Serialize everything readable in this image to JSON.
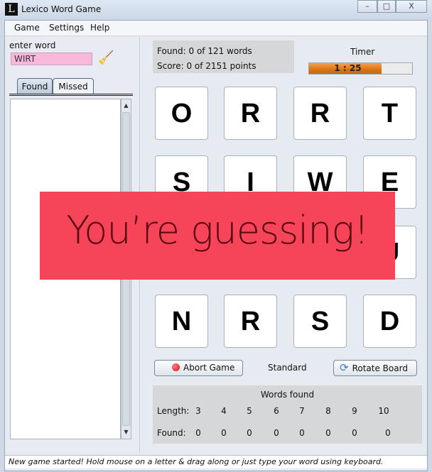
{
  "window": {
    "title": "Lexico Word Game",
    "app_icon": "L",
    "minimize": "–",
    "maximize": "□",
    "close": "X"
  },
  "menu": [
    "Game",
    "Settings",
    "Help"
  ],
  "left": {
    "enter_label": "enter word",
    "word_value": "WIRT",
    "tabs": [
      "Found",
      "Missed"
    ],
    "scroll_up": "▲",
    "scroll_down": "▼"
  },
  "stats": {
    "found": "Found: 0 of 121 words",
    "score": "Score: 0 of 2151 points"
  },
  "timer": {
    "label": "Timer",
    "value": "1 : 25",
    "progress_percent": 70,
    "color": "#d97414"
  },
  "board": [
    [
      "O",
      "R",
      "R",
      "T"
    ],
    [
      "S",
      "I",
      "W",
      "E"
    ],
    [
      "",
      "",
      "",
      "U"
    ],
    [
      "N",
      "R",
      "S",
      "D"
    ]
  ],
  "buttons": {
    "abort": "Abort Game",
    "mode": "Standard",
    "rotate": "Rotate Board"
  },
  "words_found": {
    "title": "Words found",
    "length_label": "Length:",
    "found_label": "Found:",
    "lengths": [
      "3",
      "4",
      "5",
      "6",
      "7",
      "8",
      "9",
      "10"
    ],
    "counts": [
      "0",
      "0",
      "0",
      "0",
      "0",
      "0",
      "0",
      "0"
    ]
  },
  "status": "New game started! Hold mouse on a letter & drag along or just type your word using keyboard.",
  "overlay": {
    "text": "You’re guessing!",
    "color": "#f64458"
  }
}
